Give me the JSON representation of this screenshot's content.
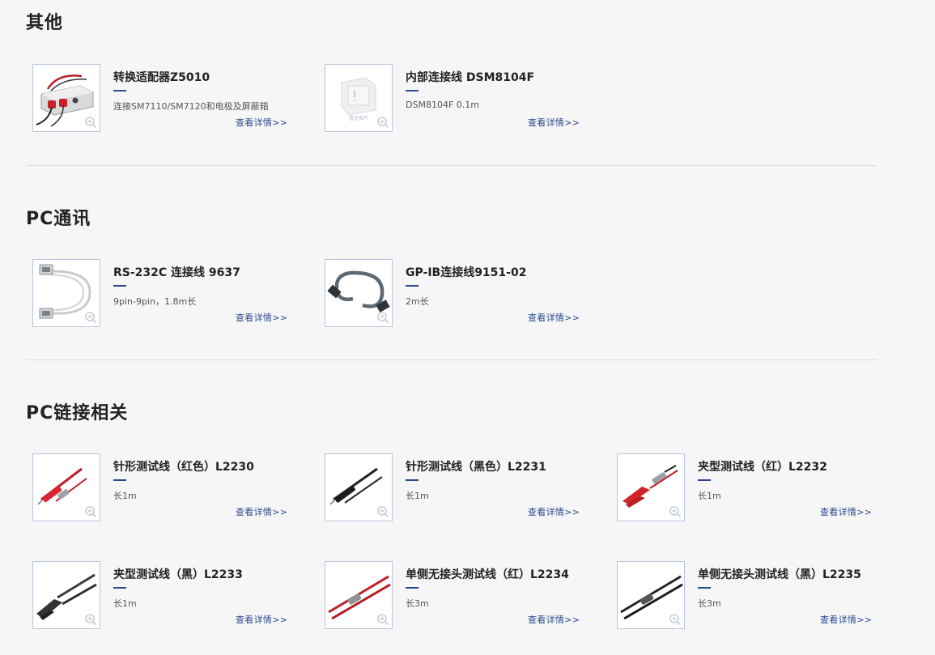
{
  "colors": {
    "accent": "#2b4a8b",
    "background": "#f6f6f7",
    "divider": "#dcdcdc",
    "thumb_border": "#b9c6dc"
  },
  "sections": [
    {
      "title": "其他",
      "products": [
        {
          "name": "转换适配器Z5010",
          "desc": "连接SM7110/SM7120和电极及屏蔽箱",
          "more": "查看详情>>",
          "image": "adapter-box"
        },
        {
          "name": "内部连接线 DSM8104F",
          "desc": "DSM8104F 0.1m",
          "more": "查看详情>>",
          "image": "placeholder",
          "placeholder_text": "暂无图片"
        }
      ]
    },
    {
      "title": "PC通讯",
      "products": [
        {
          "name": "RS-232C 连接线 9637",
          "desc": "9pin-9pin，1.8m长",
          "more": "查看详情>>",
          "image": "serial-cable"
        },
        {
          "name": "GP-IB连接线9151-02",
          "desc": "2m长",
          "more": "查看详情>>",
          "image": "gpib-cable"
        }
      ]
    },
    {
      "title": "PC链接相关",
      "products": [
        {
          "name": "针形测试线（红色）L2230",
          "desc": "长1m",
          "more": "查看详情>>",
          "image": "pin-lead-red"
        },
        {
          "name": "针形测试线（黑色）L2231",
          "desc": "长1m",
          "more": "查看详情>>",
          "image": "pin-lead-black"
        },
        {
          "name": "夹型测试线（红）L2232",
          "desc": "长1m",
          "more": "查看详情>>",
          "image": "clip-lead-red"
        },
        {
          "name": "夹型测试线（黑）L2233",
          "desc": "长1m",
          "more": "查看详情>>",
          "image": "clip-lead-black"
        },
        {
          "name": "单侧无接头测试线（红）L2234",
          "desc": "长3m",
          "more": "查看详情>>",
          "image": "bare-lead-red"
        },
        {
          "name": "单侧无接头测试线（黑）L2235",
          "desc": "长3m",
          "more": "查看详情>>",
          "image": "bare-lead-black"
        }
      ]
    }
  ]
}
